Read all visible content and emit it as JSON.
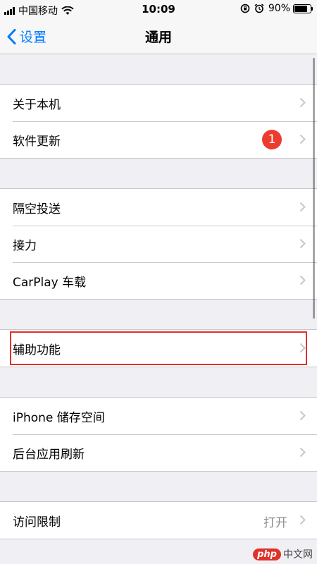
{
  "status_bar": {
    "carrier": "中国移动",
    "time": "10:09",
    "battery_percent": "90%",
    "battery_level": 0.9,
    "icons": [
      "signal-icon",
      "wifi-icon",
      "rotation-lock-icon",
      "alarm-icon",
      "battery-icon"
    ]
  },
  "nav": {
    "back_label": "设置",
    "title": "通用"
  },
  "groups": [
    {
      "items": [
        {
          "label": "关于本机"
        },
        {
          "label": "软件更新",
          "badge": "1"
        }
      ]
    },
    {
      "items": [
        {
          "label": "隔空投送"
        },
        {
          "label": "接力"
        },
        {
          "label": "CarPlay 车载"
        }
      ]
    },
    {
      "items": [
        {
          "label": "辅助功能",
          "highlighted": true
        }
      ]
    },
    {
      "items": [
        {
          "label": "iPhone 储存空间"
        },
        {
          "label": "后台应用刷新"
        }
      ]
    },
    {
      "items": [
        {
          "label": "访问限制",
          "detail": "打开"
        }
      ]
    }
  ],
  "watermark": {
    "logo": "php",
    "text": "中文网"
  },
  "colors": {
    "accent": "#007aff",
    "badge": "#ee3b2f",
    "highlight_border": "#e0312a",
    "background": "#efeff4"
  }
}
